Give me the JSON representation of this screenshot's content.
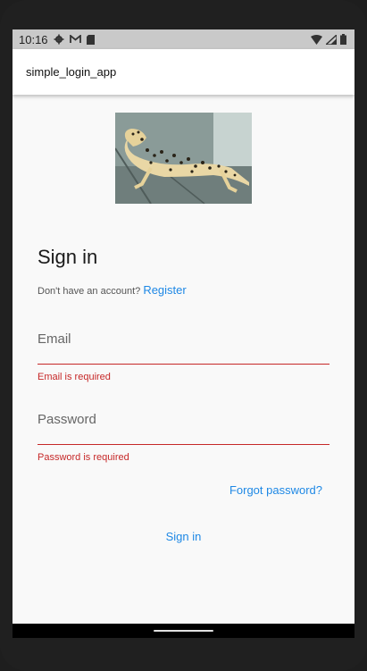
{
  "status_bar": {
    "time": "10:16",
    "icons_left": [
      "gear-icon",
      "gmail-icon",
      "sd-card-icon"
    ],
    "icons_right": [
      "wifi-icon",
      "signal-icon",
      "battery-icon"
    ]
  },
  "app_bar": {
    "title": "simple_login_app"
  },
  "hero": {
    "description_icon": "leopard-gecko-photo"
  },
  "form": {
    "title": "Sign in",
    "register_prompt": "Don't have an account?",
    "register_link": "Register",
    "email": {
      "label": "Email",
      "error": "Email is required"
    },
    "password": {
      "label": "Password",
      "error": "Password is required"
    },
    "forgot_password": "Forgot password?",
    "submit": "Sign in"
  },
  "colors": {
    "accent": "#1e88e5",
    "error": "#c62828",
    "background": "#f9f9f9",
    "status_bar": "#c9c9c9"
  }
}
